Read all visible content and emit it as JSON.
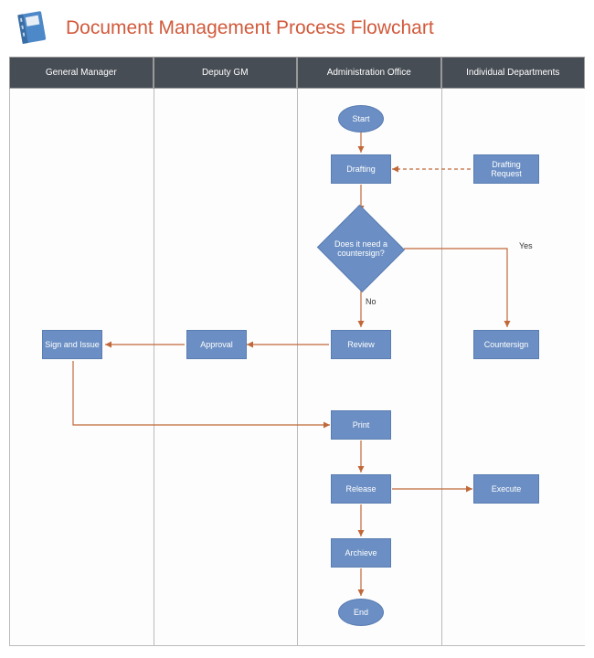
{
  "title": "Document Management Process Flowchart",
  "lanes": [
    "General Manager",
    "Deputy GM",
    "Administration Office",
    "Individual Departments"
  ],
  "nodes": {
    "start": "Start",
    "drafting": "Drafting",
    "drafting_request": "Drafting Request",
    "decision": "Does it need a countersign?",
    "review": "Review",
    "approval": "Approval",
    "sign_issue": "Sign and Issue",
    "countersign": "Countersign",
    "print": "Print",
    "release": "Release",
    "execute": "Execute",
    "archive": "Archieve",
    "end": "End"
  },
  "edge_labels": {
    "yes": "Yes",
    "no": "No"
  },
  "colors": {
    "node_fill": "#6b8fc4",
    "arrow": "#c1683a",
    "header_bg": "#474d55",
    "title_color": "#d15a3b"
  }
}
